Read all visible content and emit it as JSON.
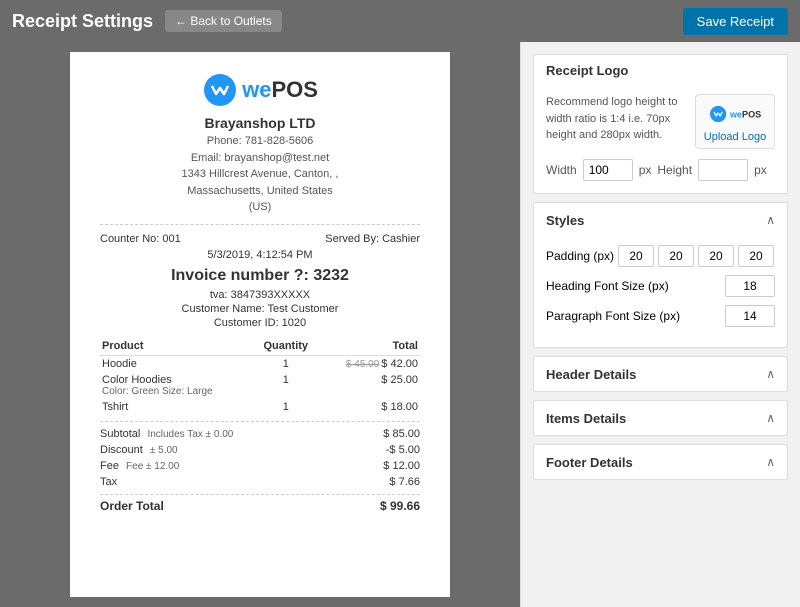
{
  "topbar": {
    "title": "Receipt Settings",
    "back_link": "← Back to Outlets",
    "save_button": "Save Receipt"
  },
  "receipt": {
    "logo_text": "wePOS",
    "shop_name": "Brayanshop LTD",
    "phone": "Phone: 781-828-5606",
    "email": "Email: brayanshop@test.net",
    "address": "1343 Hillcrest Avenue, Canton, ,",
    "address2": "Massachusetts, United States",
    "country": "(US)",
    "counter": "Counter No: 001",
    "served_by": "Served By: Cashier",
    "datetime": "5/3/2019, 4:12:54 PM",
    "invoice_label": "Invoice number ?: 3232",
    "tva": "tva: 3847393XXXXX",
    "customer_name": "Customer Name: Test Customer",
    "customer_id": "Customer ID: 1020",
    "table_headers": {
      "product": "Product",
      "quantity": "Quantity",
      "total": "Total"
    },
    "items": [
      {
        "name": "Hoodie",
        "sub": "",
        "quantity": "1",
        "original_price": "$ 45.00",
        "price": "$ 42.00"
      },
      {
        "name": "Color Hoodies",
        "sub": "Color: Green Size: Large",
        "quantity": "1",
        "original_price": "",
        "price": "$ 25.00"
      },
      {
        "name": "Tshirt",
        "sub": "",
        "quantity": "1",
        "original_price": "",
        "price": "$ 18.00"
      }
    ],
    "summary": {
      "subtotal_label": "Subtotal",
      "subtotal_sub": "Includes Tax ± 0.00",
      "subtotal_val": "$ 85.00",
      "discount_label": "Discount",
      "discount_sub": "± 5.00",
      "discount_val": "-$ 5.00",
      "fee_label": "Fee",
      "fee_sub": "Fee ± 12.00",
      "fee_val": "$ 12.00",
      "tax_label": "Tax",
      "tax_val": "$ 7.66",
      "order_total_label": "Order Total",
      "order_total_val": "$ 99.66"
    }
  },
  "panel": {
    "logo_section": {
      "title": "Receipt Logo",
      "info": "Recommend logo height to width ratio is 1:4 i.e. 70px height and 280px width.",
      "upload_label": "Upload Logo",
      "width_label": "Width",
      "width_value": "100",
      "width_unit": "px",
      "height_label": "Height",
      "height_value": "",
      "height_unit": "px"
    },
    "styles_section": {
      "title": "Styles",
      "padding_label": "Padding (px)",
      "padding_values": [
        "20",
        "20",
        "20",
        "20"
      ],
      "heading_font_label": "Heading Font Size (px)",
      "heading_font_value": "18",
      "paragraph_font_label": "Paragraph Font Size (px)",
      "paragraph_font_value": "14"
    },
    "header_section": {
      "title": "Header Details"
    },
    "items_section": {
      "title": "Items Details"
    },
    "footer_section": {
      "title": "Footer Details"
    }
  }
}
